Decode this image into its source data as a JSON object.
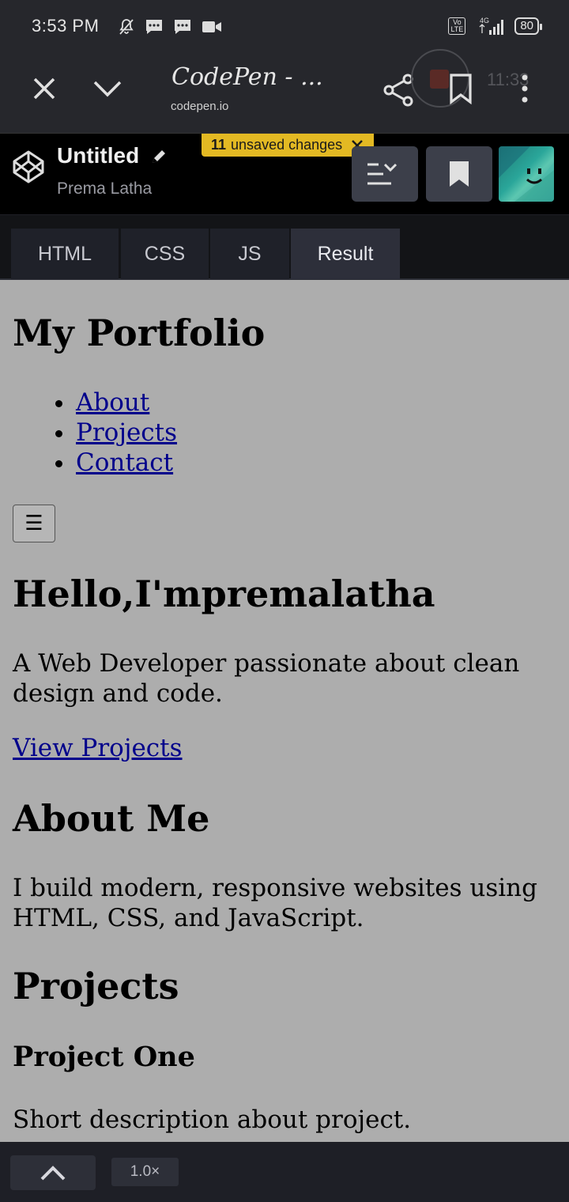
{
  "status_bar": {
    "time": "3:53 PM",
    "network": "4G",
    "battery": "80"
  },
  "browser": {
    "title": "CodePen - ...",
    "domain": "codepen.io",
    "clock": "11:33"
  },
  "codepen": {
    "pen_title": "Untitled",
    "author": "Prema Latha",
    "unsaved_count": "11",
    "unsaved_label": "unsaved changes"
  },
  "tabs": [
    {
      "label": "HTML"
    },
    {
      "label": "CSS"
    },
    {
      "label": "JS"
    },
    {
      "label": "Result",
      "active": true
    }
  ],
  "result": {
    "site_title": "My Portfolio",
    "nav": [
      {
        "label": "About"
      },
      {
        "label": "Projects"
      },
      {
        "label": "Contact"
      }
    ],
    "menu_button": "☰",
    "hero_heading": "Hello,I'mpremalatha",
    "hero_text": "A Web Developer passionate about clean design and code.",
    "cta_link": "View Projects",
    "about_heading": "About Me",
    "about_text": "I build modern, responsive websites using HTML, CSS, and JavaScript.",
    "projects_heading": "Projects",
    "project_one_title": "Project One",
    "project_one_desc": "Short description about project."
  },
  "bottom": {
    "zoom": "1.0×"
  },
  "colors": {
    "unsaved_badge": "#e3b923",
    "link": "#00008b",
    "result_bg": "#adadad"
  }
}
